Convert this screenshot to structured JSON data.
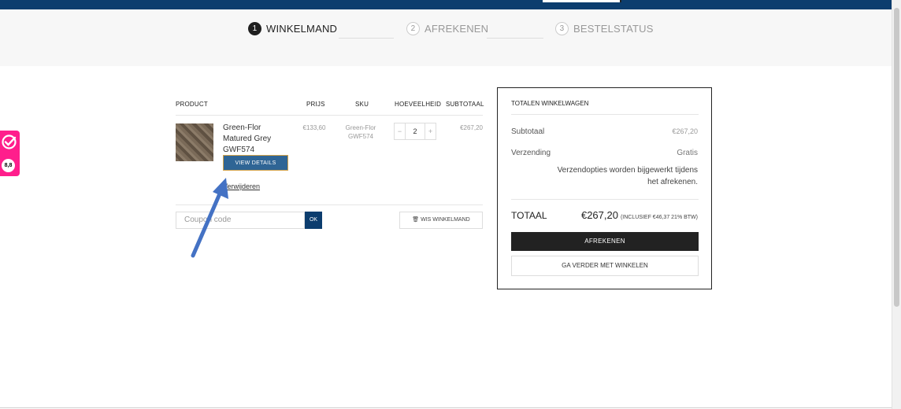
{
  "steps": [
    {
      "num": "1",
      "label": "WINKELMAND"
    },
    {
      "num": "2",
      "label": "AFREKENEN"
    },
    {
      "num": "3",
      "label": "BESTELSTATUS"
    }
  ],
  "cart": {
    "headers": {
      "product": "PRODUCT",
      "price": "PRIJS",
      "sku": "SKU",
      "quantity": "HOEVEELHEID",
      "subtotal": "SUBTOTAAL"
    },
    "item": {
      "name": "Green-Flor Matured Grey GWF574",
      "price": "€133,60",
      "sku": "Green-Flor GWF574",
      "quantity": "2",
      "subtotal": "€267,20",
      "view_details": "VIEW DETAILS",
      "remove": "Verwijderen",
      "minus": "−",
      "plus": "+"
    },
    "coupon_placeholder": "Coupon code",
    "ok": "OK",
    "clear": "🗑 WIS WINKELMAND"
  },
  "totals": {
    "title": "TOTALEN WINKELWAGEN",
    "subtotal_label": "Subtotaal",
    "subtotal_value": "€267,20",
    "shipping_label": "Verzending",
    "shipping_value": "Gratis",
    "shipping_note": "Verzendopties worden bijgewerkt tijdens het afrekenen.",
    "total_label": "TOTAAL",
    "total_value": "€267,20",
    "total_tax": "(INCLUSIEF €46,37 21% BTW)",
    "checkout": "AFREKENEN",
    "continue": "GA VERDER MET WINKELEN"
  },
  "review_badge": {
    "score": "8,8"
  },
  "colors": {
    "header": "#0c3d6e",
    "badge": "#ff1e8c",
    "view_button": "#2f6595",
    "arrow": "#4472c4"
  }
}
